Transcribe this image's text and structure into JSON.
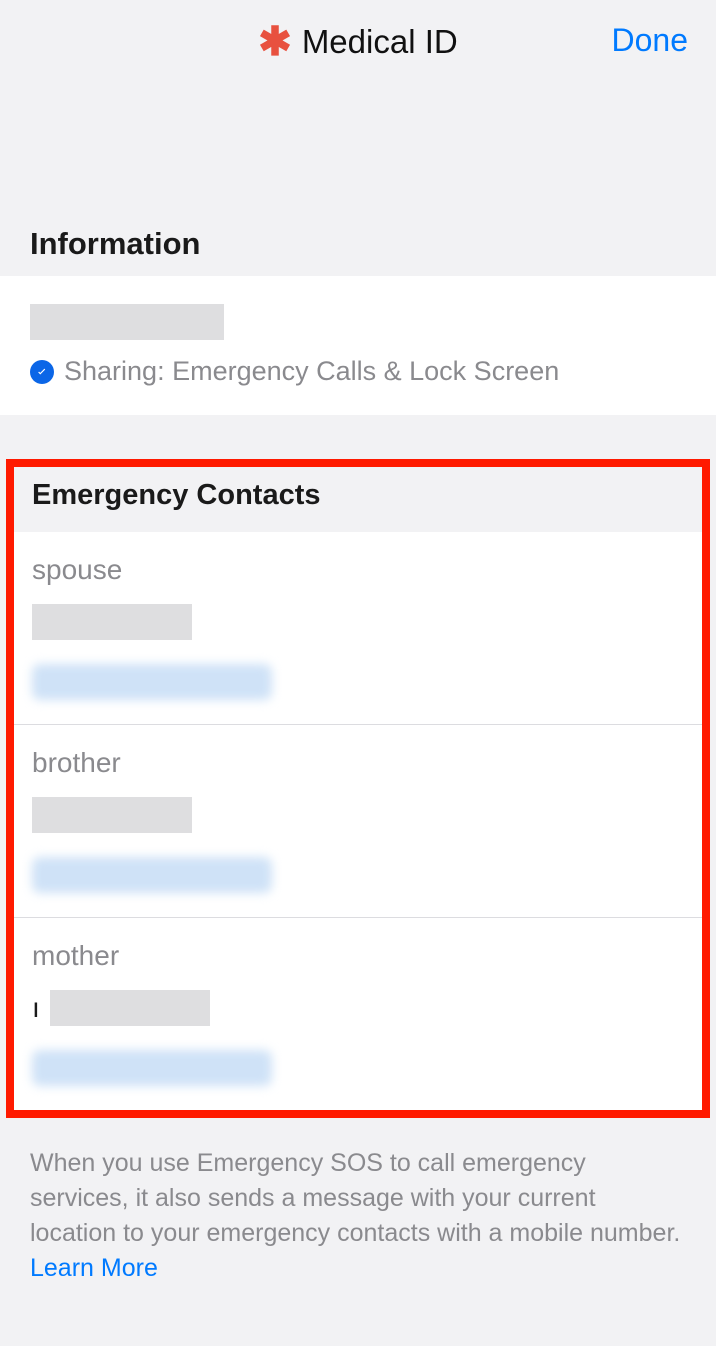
{
  "header": {
    "title": "Medical ID",
    "done_label": "Done"
  },
  "information": {
    "section_title": "Information",
    "sharing_text": "Sharing: Emergency Calls & Lock Screen"
  },
  "emergency_contacts": {
    "section_title": "Emergency Contacts",
    "contacts": [
      {
        "relation": "spouse"
      },
      {
        "relation": "brother"
      },
      {
        "relation": "mother"
      }
    ]
  },
  "footer": {
    "text": "When you use Emergency SOS to call emergency services, it also sends a message with your current location to your emergency contacts with a mobile number. ",
    "learn_more": "Learn More"
  }
}
